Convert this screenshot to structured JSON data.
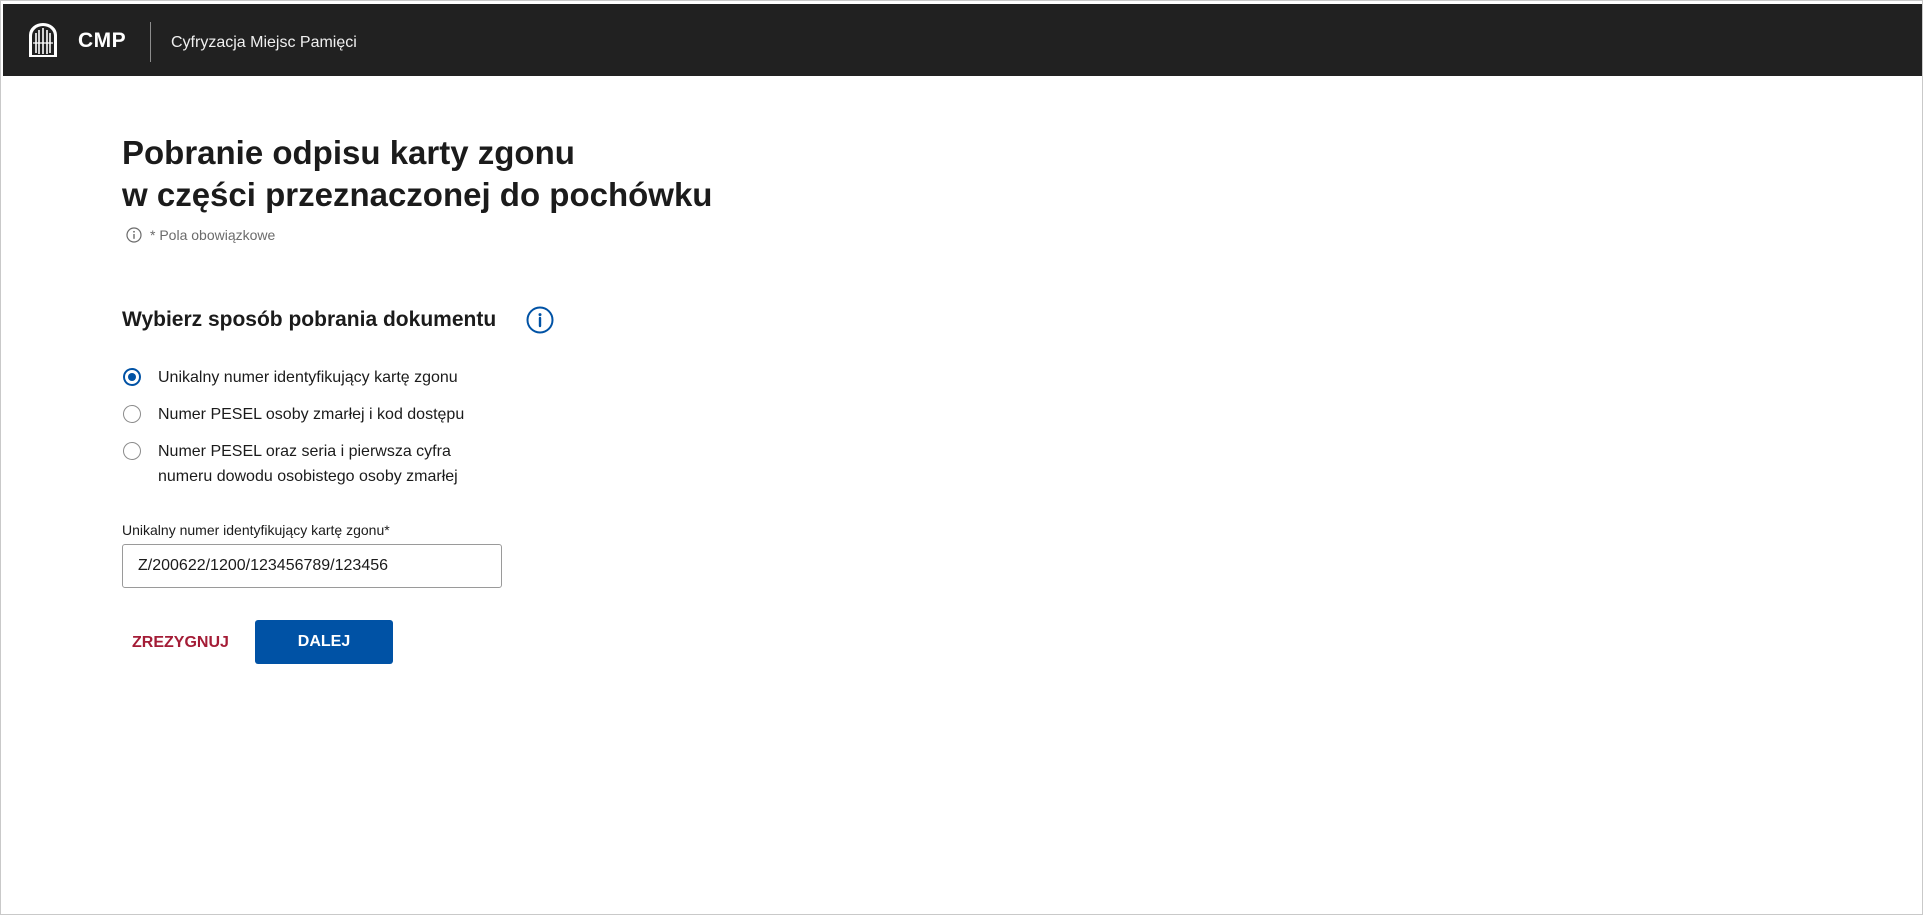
{
  "header": {
    "logo_icon": "eagle-emblem-icon",
    "brand": "CMP",
    "subtitle": "Cyfryzacja Miejsc Pamięci"
  },
  "page": {
    "title_line1": "Pobranie odpisu karty zgonu",
    "title_line2": "w części przeznaczonej do pochówku",
    "required_note": "* Pola obowiązkowe"
  },
  "section": {
    "title": "Wybierz sposób pobrania dokumentu",
    "info_icon": "info-icon",
    "selected_index": 0,
    "options": [
      {
        "label_line1": "Unikalny numer identyfikujący kartę zgonu",
        "label_line2": ""
      },
      {
        "label_line1": "Numer PESEL osoby zmarłej i kod dostępu",
        "label_line2": ""
      },
      {
        "label_line1": "Numer PESEL oraz seria i pierwsza cyfra",
        "label_line2": "numeru dowodu osobistego osoby zmarłej"
      }
    ]
  },
  "form": {
    "field_label": "Unikalny numer identyfikujący kartę zgonu*",
    "field_value": "Z/200622/1200/123456789/123456"
  },
  "actions": {
    "cancel_label": "ZREZYGNUJ",
    "next_label": "DALEJ"
  },
  "colors": {
    "header_bg": "#212121",
    "accent": "#0052a5",
    "cancel": "#a41c36"
  }
}
